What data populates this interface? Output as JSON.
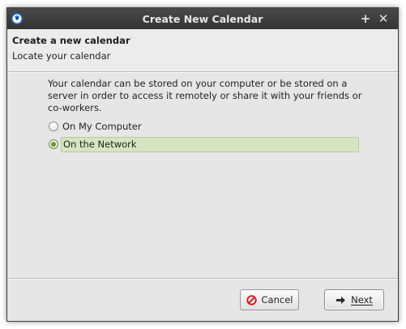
{
  "window": {
    "title": "Create New Calendar",
    "maximize_glyph": "+",
    "close_glyph": "✕"
  },
  "header": {
    "title": "Create a new calendar",
    "subtitle": "Locate your calendar"
  },
  "content": {
    "description": "Your calendar can be stored on your computer or be stored on a server in order to access it remotely or share it with your friends or co-workers.",
    "options": [
      {
        "label": "On My Computer",
        "selected": false
      },
      {
        "label": "On the Network",
        "selected": true
      }
    ]
  },
  "buttons": {
    "cancel_label": "Cancel",
    "next_label": "Next",
    "cancel_icon": "cancel-icon",
    "next_icon": "arrow-right-icon"
  },
  "colors": {
    "titlebar": "#3a3a3a",
    "selection": "#d7e4c2",
    "radio_accent": "#6d9136",
    "cancel_icon": "#d02424"
  }
}
